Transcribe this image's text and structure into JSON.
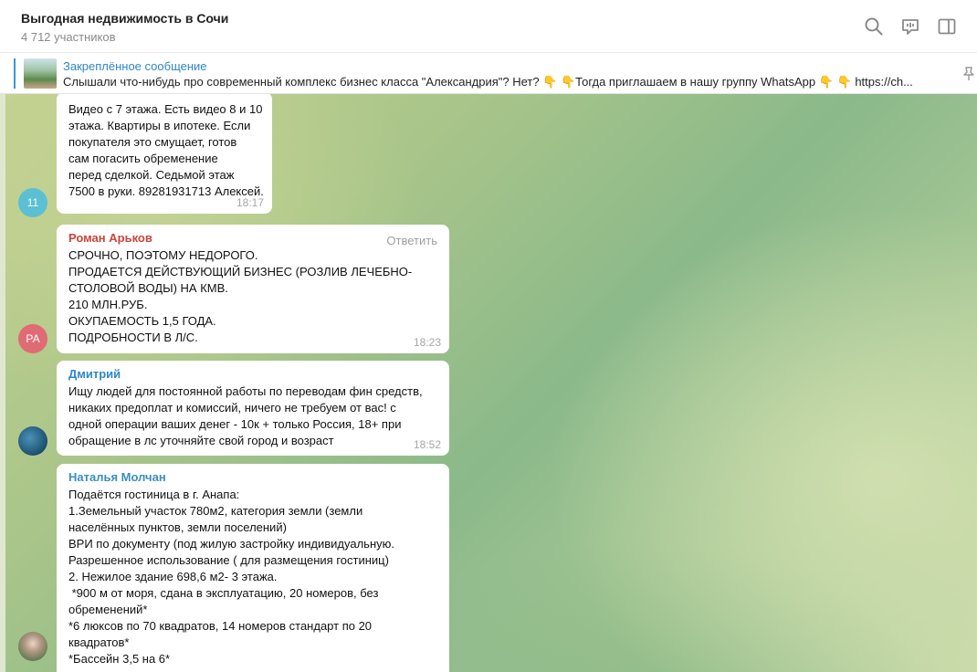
{
  "header": {
    "title": "Выгодная недвижимость в Сочи",
    "subtitle": "4 712 участников"
  },
  "pinned": {
    "title": "Закреплённое сообщение",
    "text": "Слышали что-нибудь про современный комплекс бизнес класса \"Александрия\"? Нет? 👇 👇Тогда приглашаем в нашу группу WhatsApp 👇 👇 https://ch..."
  },
  "messages": [
    {
      "avatar_text": "11",
      "avatar_color": "#5bc0d3",
      "lines": [
        "Видео с 7 этажа. Есть видео 8 и 10",
        "этажа. Квартиры в ипотеке. Если",
        "покупателя это смущает, готов",
        "сам погасить обременение",
        "перед сделкой. Седьмой этаж",
        "7500 в руки. 89281931713 Алексей."
      ],
      "time": "18:17"
    },
    {
      "author": "Роман Арьков",
      "author_color": "#c8453d",
      "avatar_text": "РА",
      "avatar_color": "#e06b74",
      "reply": "Ответить",
      "lines": [
        "СРОЧНО, ПОЭТОМУ НЕДОРОГО.",
        "ПРОДАЕТСЯ ДЕЙСТВУЮЩИЙ БИЗНЕС (РОЗЛИВ ЛЕЧЕБНО-",
        "СТОЛОВОЙ ВОДЫ) НА КМВ.",
        "210 МЛН.РУБ.",
        "ОКУПАЕМОСТЬ 1,5 ГОДА.",
        "ПОДРОБНОСТИ В Л/С."
      ],
      "time": "18:23"
    },
    {
      "author": "Дмитрий",
      "author_color": "#2e87c9",
      "lines": [
        "Ищу людей для постоянной работы по переводам фин средств,",
        "никаких предоплат и комиссий, ничего не требуем от вас! с",
        "одной операции ваших денег - 10к + только Россия, 18+ при",
        "обращение в лс уточняйте свой город и возраст"
      ],
      "time": "18:52"
    },
    {
      "author": "Наталья Молчан",
      "author_color": "#3a8fbf",
      "lines": [
        "Подаётся гостиница в г. Анапа:",
        "1.Земельный участок 780м2, категория земли (земли",
        "населённых пунктов, земли поселений)",
        "ВРИ по документу (под жилую застройку индивидуальную.",
        "Разрешенное использование ( для размещения гостиниц)",
        "2. Нежилое здание 698,6 м2- 3 этажа.",
        " *900 м от моря, сдана в эксплуатацию, 20 номеров, без",
        "обременений*",
        "*6 люксов по 70 квадратов, 14 номеров стандарт по 20",
        "квадратов*",
        "*Бассейн 3,5 на 6*"
      ]
    }
  ]
}
